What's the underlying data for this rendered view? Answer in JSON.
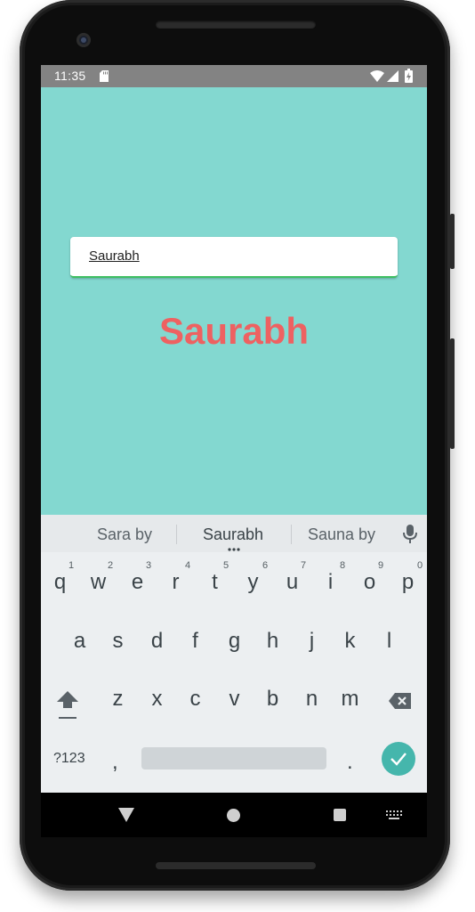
{
  "status_bar": {
    "time": "11:35"
  },
  "app": {
    "input_value": "Saurabh",
    "display_text": "Saurabh",
    "background_color": "#83d8d0",
    "display_text_color": "#ee6161"
  },
  "keyboard": {
    "suggestions": [
      "Sara by",
      "Saurabh",
      "Sauna by"
    ],
    "row1": [
      "q",
      "w",
      "e",
      "r",
      "t",
      "y",
      "u",
      "i",
      "o",
      "p"
    ],
    "row1_hints": [
      "1",
      "2",
      "3",
      "4",
      "5",
      "6",
      "7",
      "8",
      "9",
      "0"
    ],
    "row2": [
      "a",
      "s",
      "d",
      "f",
      "g",
      "h",
      "j",
      "k",
      "l"
    ],
    "row3": [
      "z",
      "x",
      "c",
      "v",
      "b",
      "n",
      "m"
    ],
    "symbols_label": "?123",
    "comma": ",",
    "period": ".",
    "accent_color": "#45b6ac"
  }
}
